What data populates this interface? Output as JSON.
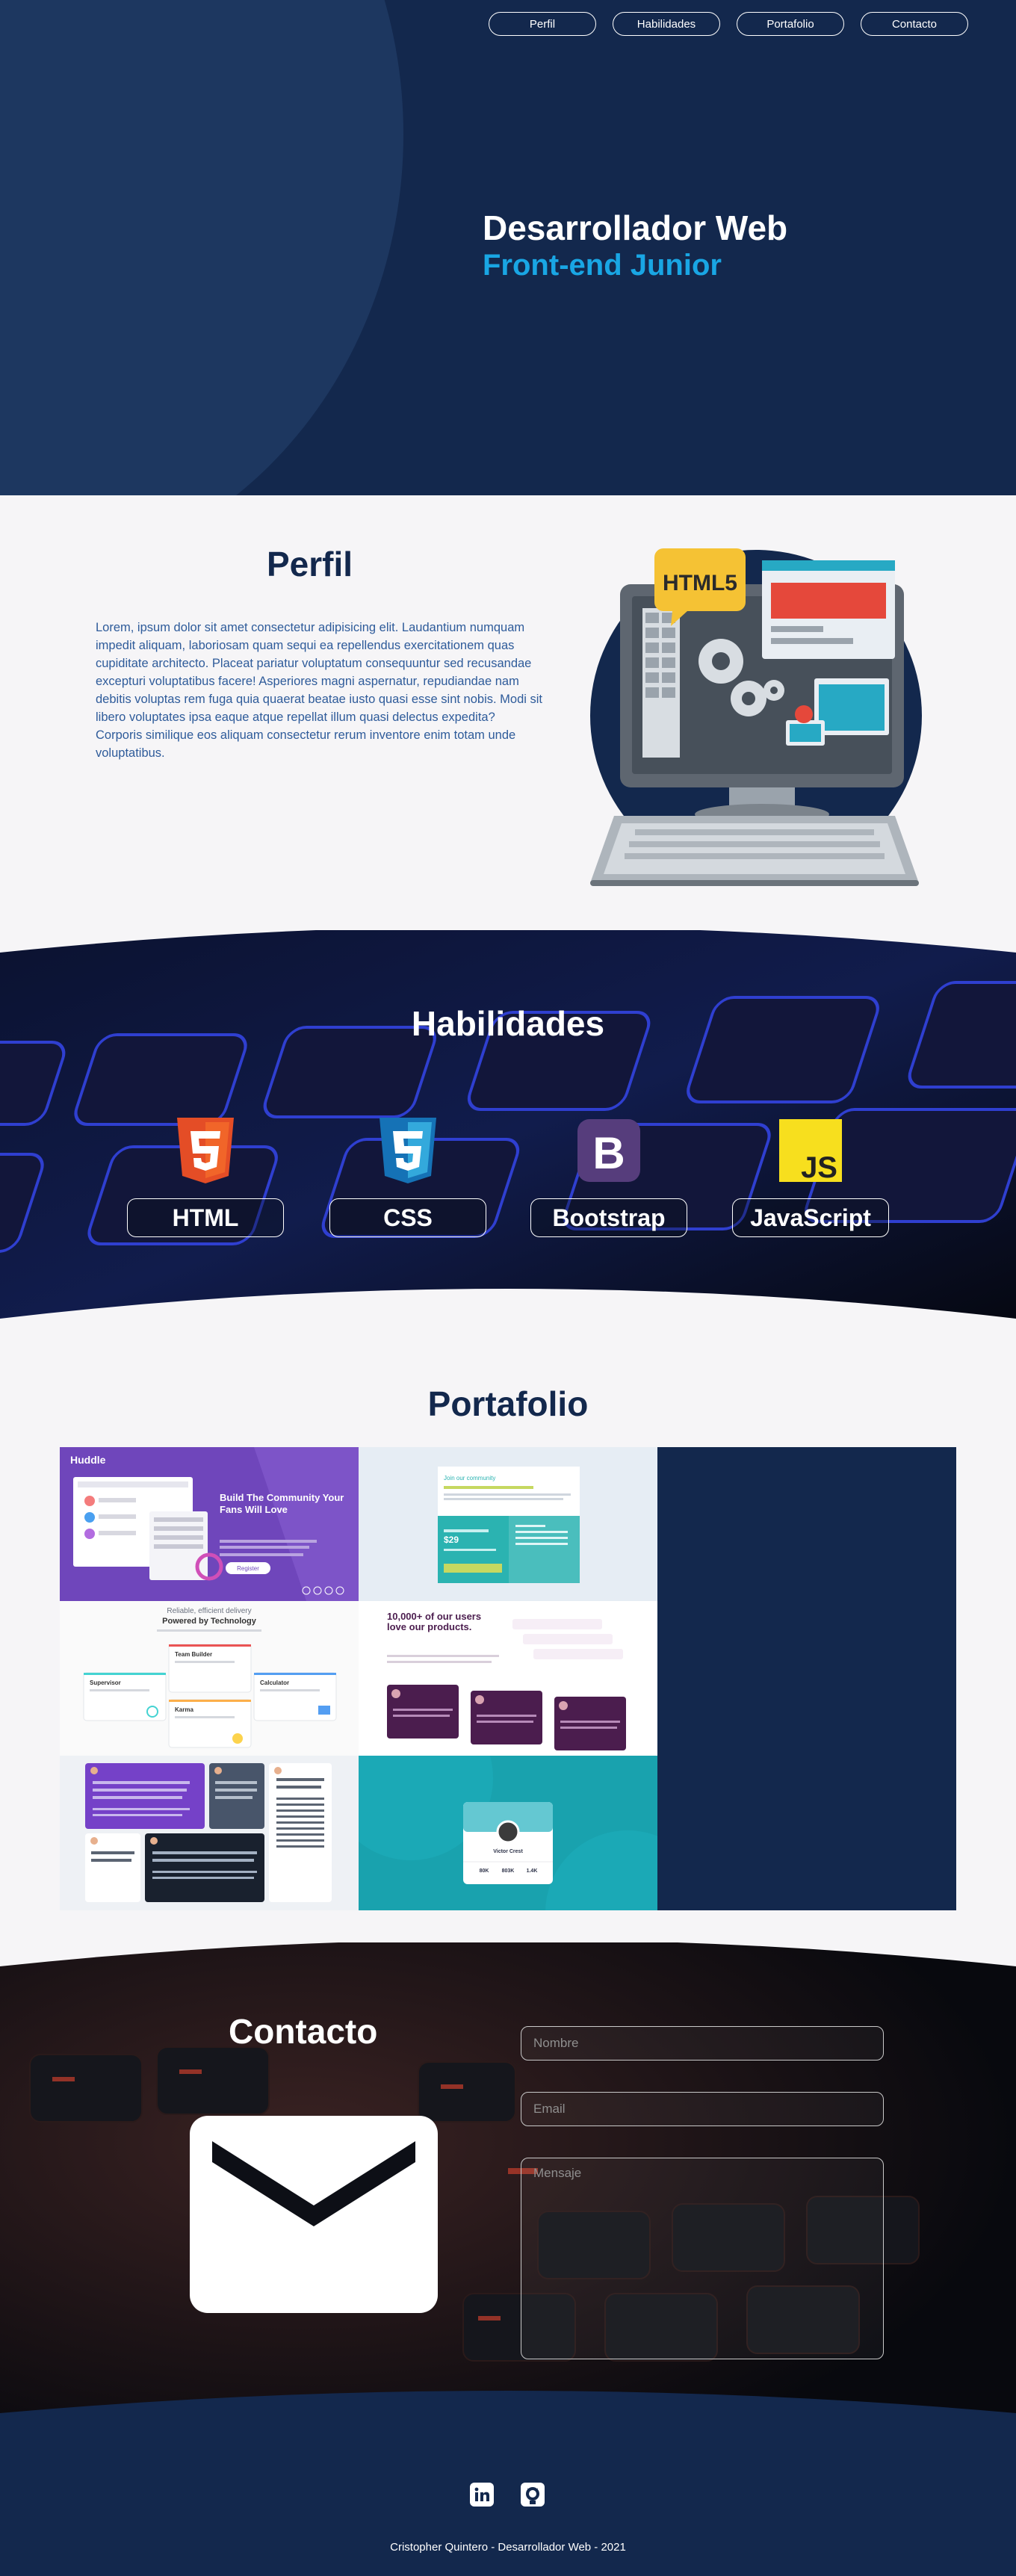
{
  "nav": {
    "items": [
      {
        "label": "Perfil"
      },
      {
        "label": "Habilidades"
      },
      {
        "label": "Portafolio"
      },
      {
        "label": "Contacto"
      }
    ]
  },
  "hero": {
    "title": "Desarrollador Web",
    "subtitle": "Front-end Junior"
  },
  "perfil": {
    "title": "Perfil",
    "text": "Lorem, ipsum dolor sit amet consectetur adipisicing elit. Laudantium numquam impedit aliquam, laboriosam quam sequi ea repellendus exercitationem quas cupiditate architecto. Placeat pariatur voluptatum consequuntur sed recusandae excepturi voluptatibus facere! Asperiores magni aspernatur, repudiandae nam debitis voluptas rem fuga quia quaerat beatae iusto quasi esse sint nobis. Modi sit libero voluptates ipsa eaque atque repellat illum quasi delectus expedita? Corporis similique eos aliquam consectetur rerum inventore enim totam unde voluptatibus.",
    "illustration_label": "HTML5"
  },
  "skills": {
    "title": "Habilidades",
    "items": [
      {
        "label": "HTML",
        "icon": "html5-icon",
        "color": "#e44d26"
      },
      {
        "label": "CSS",
        "icon": "css3-icon",
        "color": "#1572b6"
      },
      {
        "label": "Bootstrap",
        "icon": "bootstrap-icon",
        "color": "#563d7c"
      },
      {
        "label": "JavaScript",
        "icon": "javascript-icon",
        "color": "#f7df1e"
      }
    ]
  },
  "portfolio": {
    "title": "Portafolio",
    "projects": [
      {
        "name": "huddle-landing",
        "brand": "Huddle",
        "headline": "Build The Community Your Fans Will Love",
        "button": "Register"
      },
      {
        "name": "single-price-grid",
        "headline": "Join our community",
        "price": "$29"
      },
      {
        "name": "four-card-feature",
        "small": "Reliable, efficient delivery",
        "headline": "Powered by Technology",
        "cards": [
          "Supervisor",
          "Team Builder",
          "Karma",
          "Calculator"
        ]
      },
      {
        "name": "social-proof",
        "headline": "10,000+ of our users love our products."
      },
      {
        "name": "testimonials-grid"
      },
      {
        "name": "profile-card",
        "person": "Victor Crest",
        "stats": [
          "80K",
          "803K",
          "1.4K"
        ]
      }
    ]
  },
  "contact": {
    "title": "Contacto",
    "placeholders": {
      "nombre": "Nombre",
      "email": "Email",
      "mensaje": "Mensaje"
    }
  },
  "footer": {
    "text": "Cristopher Quintero - Desarrollador Web - 2021",
    "social": [
      "linkedin-icon",
      "github-icon"
    ]
  },
  "colors": {
    "navy": "#13284d",
    "accent": "#19a6e4",
    "light_bg": "#f6f5f7"
  }
}
